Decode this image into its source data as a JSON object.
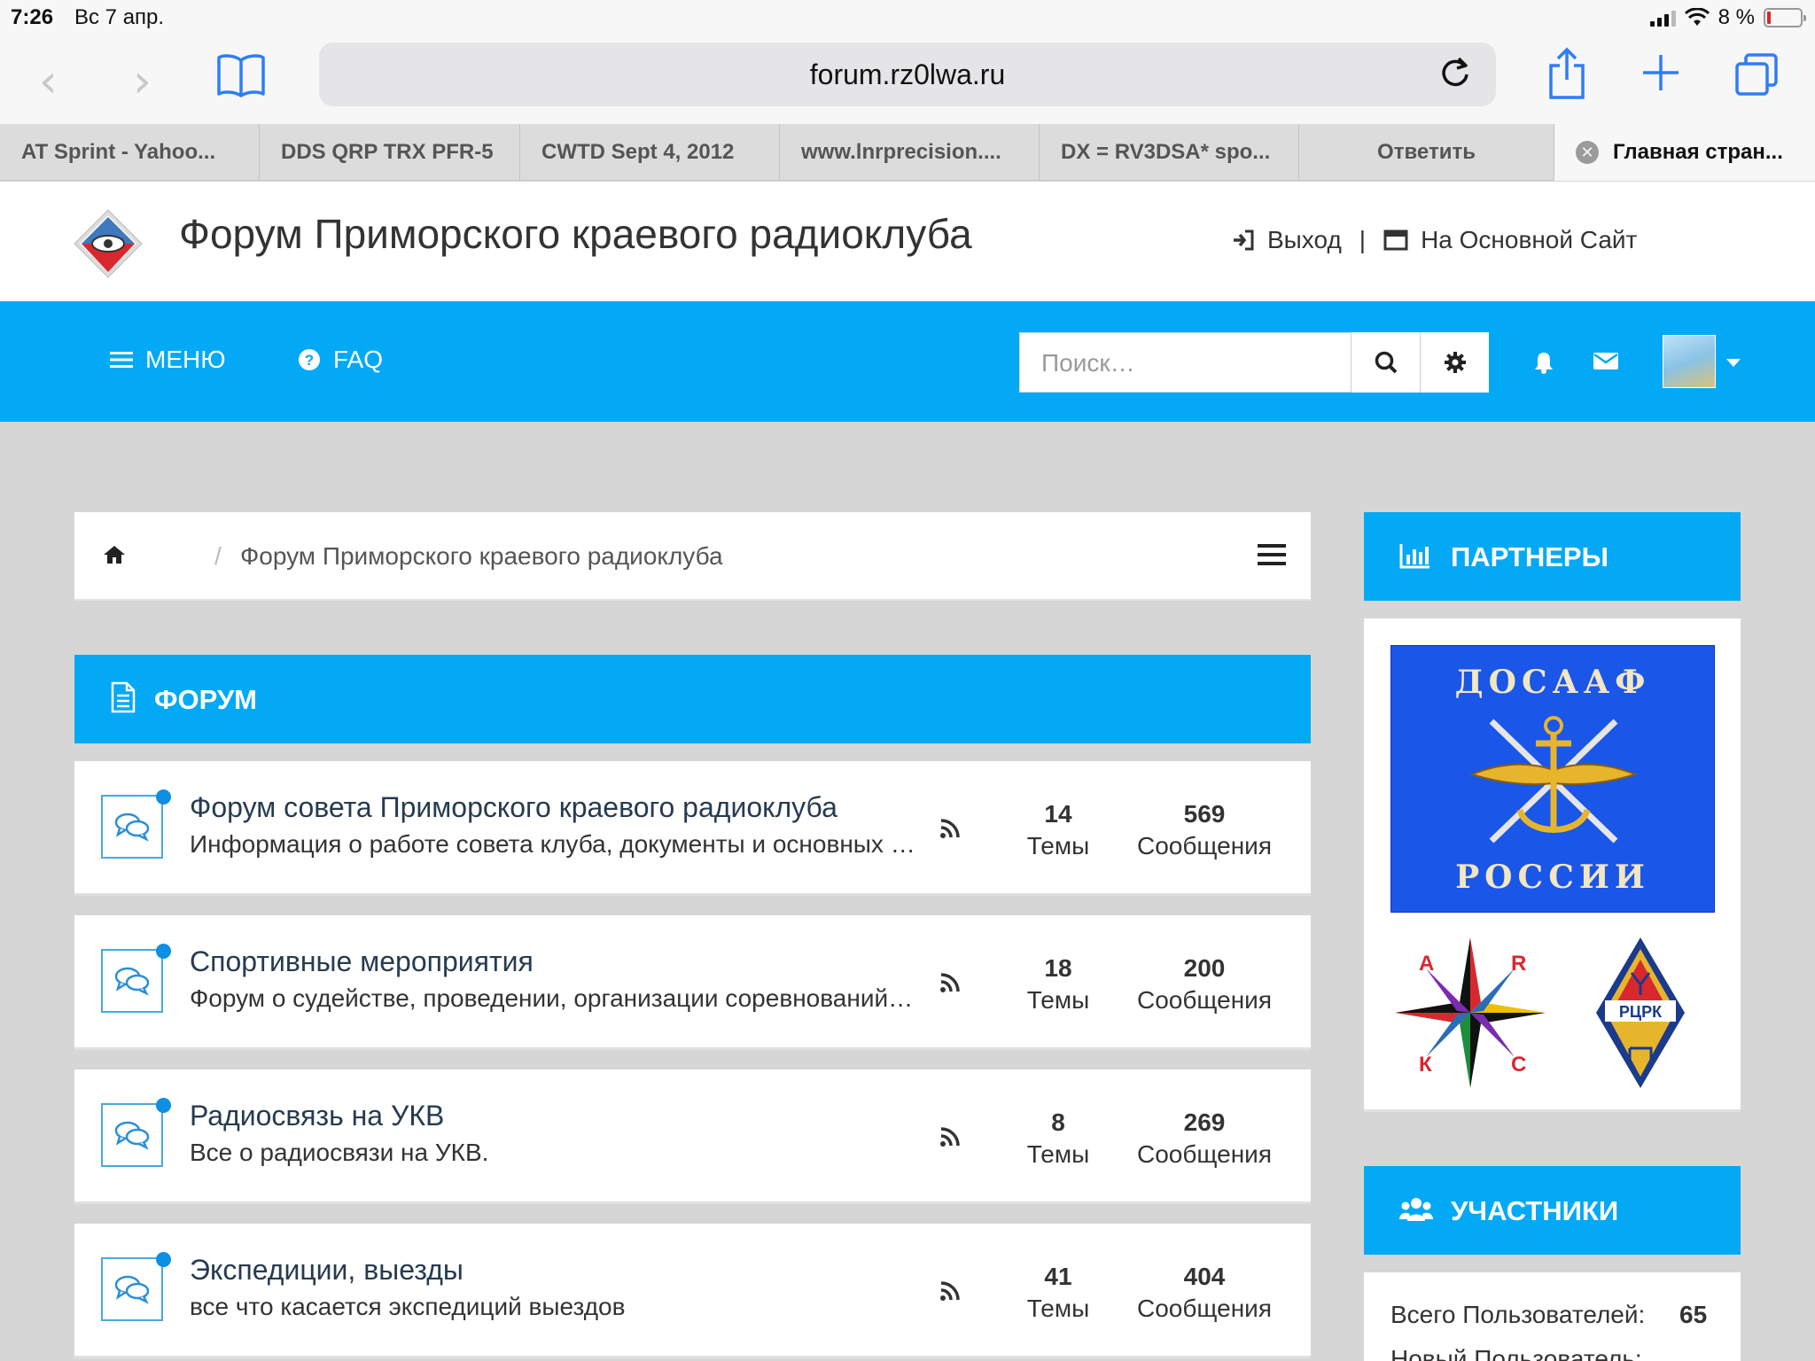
{
  "status_bar": {
    "time": "7:26",
    "date": "Вс 7 апр.",
    "battery": "8 %"
  },
  "browser": {
    "url": "forum.rz0lwa.ru",
    "tabs": [
      {
        "label": "AT Sprint - Yahoo..."
      },
      {
        "label": "DDS QRP TRX PFR-5"
      },
      {
        "label": "CWTD Sept 4, 2012"
      },
      {
        "label": "www.lnrprecision...."
      },
      {
        "label": "DX = RV3DSA* spo..."
      },
      {
        "label": "Ответить"
      },
      {
        "label": "Главная стран...",
        "active": true
      }
    ]
  },
  "header": {
    "title": "Форум Приморского краевого радиоклуба",
    "logout": "Выход",
    "separator": "|",
    "main_site": "На Основной Сайт"
  },
  "nav": {
    "menu": "МЕНЮ",
    "faq": "FAQ",
    "search_placeholder": "Поиск…"
  },
  "breadcrumb": {
    "current": "Форум Приморского краевого радиоклуба",
    "separator": "/"
  },
  "forum_section": {
    "title": "ФОРУМ",
    "forums": [
      {
        "title": "Форум совета Приморского краевого радиоклуба",
        "desc": "Информация о работе совета клуба, документы и основных направлениях",
        "topics": "14",
        "topics_label": "Темы",
        "posts": "569",
        "posts_label": "Сообщения"
      },
      {
        "title": "Спортивные мероприятия",
        "desc": "Форум о судействе, проведении, организации соревнований и мероприятий",
        "topics": "18",
        "topics_label": "Темы",
        "posts": "200",
        "posts_label": "Сообщения"
      },
      {
        "title": "Радиосвязь на УКВ",
        "desc": "Все о радиосвязи на УКВ.",
        "topics": "8",
        "topics_label": "Темы",
        "posts": "269",
        "posts_label": "Сообщения"
      },
      {
        "title": "Экспедиции, выезды",
        "desc": "все что касается экспедиций выездов",
        "topics": "41",
        "topics_label": "Темы",
        "posts": "404",
        "posts_label": "Сообщения"
      }
    ]
  },
  "sidebar": {
    "partners_title": "ПАРТНЕРЫ",
    "dosaaf_top": "ДОСААФ",
    "dosaaf_bottom": "РОССИИ",
    "akrks_letters": [
      "А",
      "R",
      "К",
      "С"
    ],
    "rcrk_label": "РЦРК",
    "members_title": "УЧАСТНИКИ",
    "total_users_label": "Всего Пользователей:",
    "total_users": "65",
    "new_user_label": "Новый Пользователь:"
  },
  "colors": {
    "accent": "#03a9f4",
    "ios_blue": "#2f7df6"
  }
}
